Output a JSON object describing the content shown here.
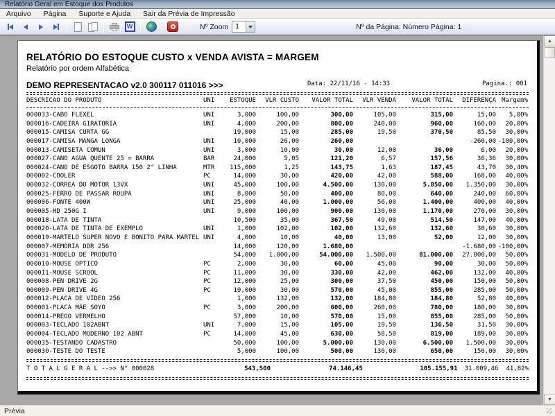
{
  "window": {
    "title": "Relatório Geral em Estoque dos Produtos"
  },
  "menu": {
    "items": [
      "Arquivo",
      "Página",
      "Suporte e Ajuda",
      "Sair da Prévia de Impressão"
    ]
  },
  "toolbar": {
    "icons": [
      "first-page",
      "previous-page",
      "next-page",
      "last-page",
      "single-page-view",
      "two-page-view",
      "print",
      "export-word",
      "export-web",
      "close-preview"
    ],
    "word_icon_letter": "W",
    "zoom_label": "Nº Zoom",
    "zoom_value": "1",
    "page_info": "Nº da Página: Número Página: 1"
  },
  "colors": {
    "titlebar": "#9db1c7",
    "workspace": "#a8a8a8",
    "arrow_blue": "#3f63b0",
    "word_blue": "#2b3cc4",
    "exit_red": "#b71f16"
  },
  "report": {
    "title": "RELATÓRIO DO ESTOQUE CUSTO x VENDA AVISTA = MARGEM",
    "subtitle": "Relatório por ordem Alfabética",
    "company": "DEMO REPRESENTACAO v2.0 300117 011016 >>>",
    "date_label": "Data: 22/11/16 - 14:33",
    "page_label": "Pagina.: 001",
    "columns": [
      "DESCRICAO DO PRODUTO",
      "UNI",
      "ESTOQUE",
      "VLR CUSTO",
      "VALOR TOTAL",
      "VLR VENDA",
      "VALOR TOTAL",
      "DIFERENÇA",
      "Margem%"
    ],
    "rows": [
      {
        "desc": "000033-CABO FLEXEL",
        "uni": "UNI",
        "estoque": "3,000",
        "custo": "100,00",
        "vt_custo": "300,00",
        "venda": "105,00",
        "vt_venda": "315,00",
        "dif": "15,00",
        "margem": "5,00%"
      },
      {
        "desc": "000016-CADEIRA GIRATORIA",
        "uni": "UNI",
        "estoque": "4,000",
        "custo": "200,00",
        "vt_custo": "800,00",
        "venda": "240,00",
        "vt_venda": "960,00",
        "dif": "160,00",
        "margem": "20,00%"
      },
      {
        "desc": "000015-CAMISA CURTA GG",
        "uni": "",
        "estoque": "19,000",
        "custo": "15,00",
        "vt_custo": "285,00",
        "venda": "19,50",
        "vt_venda": "370,50",
        "dif": "85,50",
        "margem": "30,00%"
      },
      {
        "desc": "000017-CAMISA MANGA LONGA",
        "uni": "UNI",
        "estoque": "10,000",
        "custo": "26,00",
        "vt_custo": "260,00",
        "venda": "",
        "vt_venda": "",
        "dif": "-260,00",
        "margem": "-100,00%"
      },
      {
        "desc": "000013-CAMISETA COMUN",
        "uni": "UNI",
        "estoque": "3,000",
        "custo": "10,00",
        "vt_custo": "30,00",
        "venda": "12,00",
        "vt_venda": "36,00",
        "dif": "6,00",
        "margem": "20,00%"
      },
      {
        "desc": "000027-CANO AGUA QUENTE 25 = BARRA",
        "uni": "BAR",
        "estoque": "24,000",
        "custo": "5,05",
        "vt_custo": "121,20",
        "venda": "6,57",
        "vt_venda": "157,56",
        "dif": "36,36",
        "margem": "30,00%"
      },
      {
        "desc": "000024-CANO DE ESGOTO BARRA 150 2° LINHA",
        "uni": "MTR",
        "estoque": "115,000",
        "custo": "1,25",
        "vt_custo": "143,75",
        "venda": "1,63",
        "vt_venda": "187,45",
        "dif": "43,70",
        "margem": "30,40%"
      },
      {
        "desc": "000002-COOLER",
        "uni": "PC",
        "estoque": "14,000",
        "custo": "30,00",
        "vt_custo": "420,00",
        "venda": "42,00",
        "vt_venda": "588,00",
        "dif": "168,00",
        "margem": "40,00%"
      },
      {
        "desc": "000032-CORREA DO MOTOR 13VX",
        "uni": "UNI",
        "estoque": "45,000",
        "custo": "100,00",
        "vt_custo": "4.500,00",
        "venda": "130,00",
        "vt_venda": "5.850,00",
        "dif": "1.350,00",
        "margem": "30,00%"
      },
      {
        "desc": "000025-FERRO DE PASSAR ROUPA",
        "uni": "UNI",
        "estoque": "8,000",
        "custo": "50,00",
        "vt_custo": "400,00",
        "venda": "80,00",
        "vt_venda": "640,00",
        "dif": "240,00",
        "margem": "60,00%"
      },
      {
        "desc": "000006-FONTE 400W",
        "uni": "UNI",
        "estoque": "25,000",
        "custo": "40,00",
        "vt_custo": "1.000,00",
        "venda": "56,00",
        "vt_venda": "1.400,00",
        "dif": "400,00",
        "margem": "40,00%"
      },
      {
        "desc": "000005-HD 250G  I",
        "uni": "UNI",
        "estoque": "9,000",
        "custo": "100,00",
        "vt_custo": "900,00",
        "venda": "130,00",
        "vt_venda": "1.170,00",
        "dif": "270,00",
        "margem": "30,00%"
      },
      {
        "desc": "000018-LATA DE TINTA",
        "uni": "",
        "estoque": "10,500",
        "custo": "35,00",
        "vt_custo": "367,50",
        "venda": "49,00",
        "vt_venda": "514,50",
        "dif": "147,00",
        "margem": "40,00%"
      },
      {
        "desc": "000020-LATA DE TINTA DE EXEMPLO",
        "uni": "UNI",
        "estoque": "1,000",
        "custo": "102,00",
        "vt_custo": "102,00",
        "venda": "132,60",
        "vt_venda": "132,60",
        "dif": "30,60",
        "margem": "30,00%"
      },
      {
        "desc": "000019-MARTELO SUPER NOVO E BONITO PARA MARTEL",
        "uni": "UNI",
        "estoque": "4,000",
        "custo": "10,00",
        "vt_custo": "40,00",
        "venda": "13,00",
        "vt_venda": "52,00",
        "dif": "12,00",
        "margem": "30,00%"
      },
      {
        "desc": "000007-MEMÓRIA DDR 256",
        "uni": "",
        "estoque": "14,000",
        "custo": "120,00",
        "vt_custo": "1.680,00",
        "venda": "",
        "vt_venda": "",
        "dif": "-1.680,00",
        "margem": "-100,00%"
      },
      {
        "desc": "000031-MODELO DE PRODUTO",
        "uni": "",
        "estoque": "54,000",
        "custo": "1.000,00",
        "vt_custo": "54.000,00",
        "venda": "1.500,00",
        "vt_venda": "81.000,00",
        "dif": "27.000,00",
        "margem": "50,00%"
      },
      {
        "desc": "000010-MOUSE OPTICO",
        "uni": "PC",
        "estoque": "2,000",
        "custo": "30,00",
        "vt_custo": "60,00",
        "venda": "45,00",
        "vt_venda": "90,00",
        "dif": "30,00",
        "margem": "50,00%"
      },
      {
        "desc": "000011-MOUSE SCROOL",
        "uni": "PC",
        "estoque": "11,000",
        "custo": "30,00",
        "vt_custo": "330,00",
        "venda": "42,00",
        "vt_venda": "462,00",
        "dif": "132,00",
        "margem": "40,00%"
      },
      {
        "desc": "000008-PEN DRIVE 2G",
        "uni": "PC",
        "estoque": "12,000",
        "custo": "25,00",
        "vt_custo": "300,00",
        "venda": "37,50",
        "vt_venda": "450,00",
        "dif": "150,00",
        "margem": "50,00%"
      },
      {
        "desc": "000009-PEN DRIVE 4G",
        "uni": "PC",
        "estoque": "19,000",
        "custo": "30,00",
        "vt_custo": "570,00",
        "venda": "45,00",
        "vt_venda": "855,00",
        "dif": "285,00",
        "margem": "50,00%"
      },
      {
        "desc": "000012-PLACA DE VÍDEO 256",
        "uni": "",
        "estoque": "1,000",
        "custo": "132,00",
        "vt_custo": "132,00",
        "venda": "184,80",
        "vt_venda": "184,80",
        "dif": "52,80",
        "margem": "40,00%"
      },
      {
        "desc": "000001-PLACA MÃE SOYO",
        "uni": "PC",
        "estoque": "3,000",
        "custo": "200,00",
        "vt_custo": "600,00",
        "venda": "260,00",
        "vt_venda": "780,00",
        "dif": "180,00",
        "margem": "30,00%"
      },
      {
        "desc": "000014-PREGO VERMELHO",
        "uni": "",
        "estoque": "57,000",
        "custo": "10,00",
        "vt_custo": "570,00",
        "venda": "15,00",
        "vt_venda": "855,00",
        "dif": "285,00",
        "margem": "50,00%"
      },
      {
        "desc": "000003-TECLADO 102ABNT",
        "uni": "UNI",
        "estoque": "7,000",
        "custo": "15,00",
        "vt_custo": "105,00",
        "venda": "19,50",
        "vt_venda": "136,50",
        "dif": "31,50",
        "margem": "30,00%"
      },
      {
        "desc": "000004-TECLADO MODERNO 102 ABNT",
        "uni": "PC",
        "estoque": "14,000",
        "custo": "45,00",
        "vt_custo": "630,00",
        "venda": "58,50",
        "vt_venda": "819,00",
        "dif": "189,00",
        "margem": "30,00%"
      },
      {
        "desc": "000035-TESTANDO CADASTRO",
        "uni": "",
        "estoque": "50,000",
        "custo": "100,00",
        "vt_custo": "5.000,00",
        "venda": "130,00",
        "vt_venda": "6.500,00",
        "dif": "1.500,00",
        "margem": "30,00%"
      },
      {
        "desc": "000030-TESTE DO TESTE",
        "uni": "",
        "estoque": "5,000",
        "custo": "100,00",
        "vt_custo": "500,00",
        "venda": "130,00",
        "vt_venda": "650,00",
        "dif": "150,00",
        "margem": "30,00%"
      }
    ],
    "total": {
      "label": "T O T A L   G E R A L   -->> N° 000028",
      "estoque": "543,500",
      "vt_custo": "74.146,45",
      "vt_venda": "105.155,91",
      "dif": "31.009,46",
      "margem": "41,82%"
    }
  },
  "statusbar": {
    "text": "Prévia"
  }
}
